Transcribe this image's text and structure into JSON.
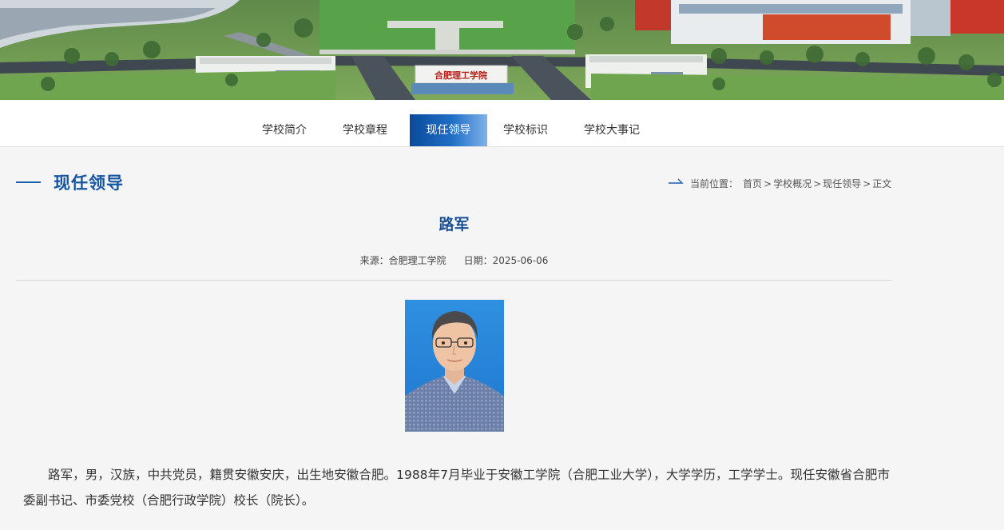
{
  "banner": {
    "gate_sign": "合肥理工学院"
  },
  "nav": {
    "items": [
      {
        "label": "学校简介"
      },
      {
        "label": "学校章程"
      },
      {
        "label": "现任领导"
      },
      {
        "label": "学校标识"
      },
      {
        "label": "学校大事记"
      }
    ],
    "active": "现任领导"
  },
  "section": {
    "title": "现任领导"
  },
  "breadcrumb": {
    "prefix": "当前位置：",
    "items": [
      "首页",
      "学校概况",
      "现任领导",
      "正文"
    ],
    "separator": ">"
  },
  "article": {
    "title": "路军",
    "source_label": "来源：合肥理工学院",
    "date_label": "日期：2025-06-06",
    "body": "路军，男，汉族，中共党员，籍贯安徽安庆，出生地安徽合肥。1988年7月毕业于安徽工学院（合肥工业大学），大学学历，工学学士。现任安徽省合肥市委副书记、市委党校（合肥行政学院）校长（院长）。"
  },
  "colors": {
    "accent": "#1556a3",
    "nav_active_start": "#0b4a9a",
    "nav_active_end": "#7fb2ea",
    "page_bg": "#f5f5f5"
  }
}
